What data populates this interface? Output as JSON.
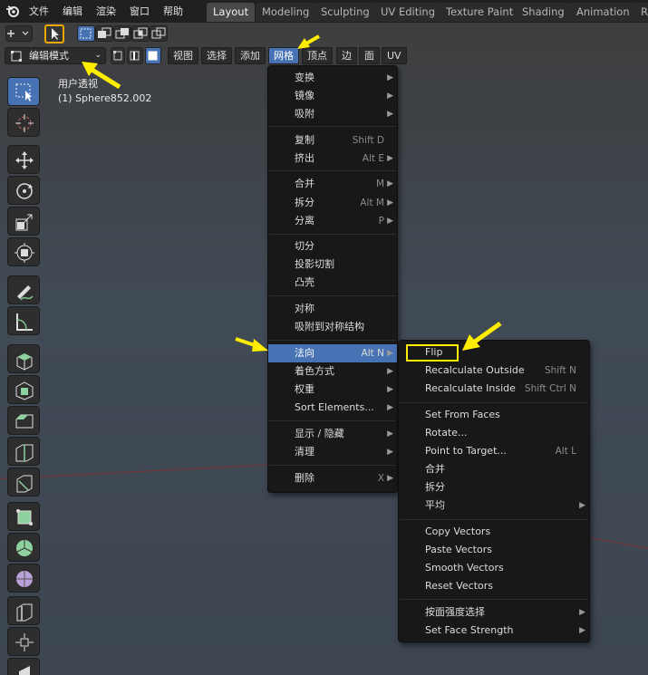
{
  "topbar": {
    "menus": [
      "文件",
      "编辑",
      "渲染",
      "窗口",
      "帮助"
    ],
    "tabs": [
      "Layout",
      "Modeling",
      "Sculpting",
      "UV Editing",
      "Texture Paint",
      "Shading",
      "Animation",
      "R"
    ]
  },
  "header": {
    "mode": "编辑模式",
    "menus": [
      "视图",
      "选择",
      "添加",
      "网格",
      "顶点",
      "边",
      "面",
      "UV"
    ]
  },
  "viewport": {
    "view_name": "用户透视",
    "object_name": "(1) Sphere852.002"
  },
  "mesh_menu": {
    "items": [
      {
        "label": "变换",
        "shortcut": "",
        "sub": true
      },
      {
        "label": "镜像",
        "shortcut": "",
        "sub": true
      },
      {
        "label": "吸附",
        "shortcut": "",
        "sub": true
      },
      {
        "label": "复制",
        "shortcut": "Shift D",
        "sub": false
      },
      {
        "label": "挤出",
        "shortcut": "Alt E",
        "sub": true
      },
      {
        "label": "合并",
        "shortcut": "M",
        "sub": true
      },
      {
        "label": "拆分",
        "shortcut": "Alt M",
        "sub": true
      },
      {
        "label": "分离",
        "shortcut": "P",
        "sub": true
      },
      {
        "label": "切分",
        "shortcut": "",
        "sub": false
      },
      {
        "label": "投影切割",
        "shortcut": "",
        "sub": false
      },
      {
        "label": "凸壳",
        "shortcut": "",
        "sub": false
      },
      {
        "label": "对称",
        "shortcut": "",
        "sub": false
      },
      {
        "label": "吸附到对称结构",
        "shortcut": "",
        "sub": false
      },
      {
        "label": "法向",
        "shortcut": "Alt N",
        "sub": true
      },
      {
        "label": "着色方式",
        "shortcut": "",
        "sub": true
      },
      {
        "label": "权重",
        "shortcut": "",
        "sub": true
      },
      {
        "label": "Sort Elements...",
        "shortcut": "",
        "sub": true
      },
      {
        "label": "显示 / 隐藏",
        "shortcut": "",
        "sub": true
      },
      {
        "label": "清理",
        "shortcut": "",
        "sub": true
      },
      {
        "label": "删除",
        "shortcut": "X",
        "sub": true
      }
    ]
  },
  "normals_menu": {
    "items": [
      {
        "label": "Flip",
        "shortcut": "",
        "sub": false
      },
      {
        "label": "Recalculate Outside",
        "shortcut": "Shift N",
        "sub": false
      },
      {
        "label": "Recalculate Inside",
        "shortcut": "Shift Ctrl N",
        "sub": false
      },
      {
        "label": "Set From Faces",
        "shortcut": "",
        "sub": false
      },
      {
        "label": "Rotate...",
        "shortcut": "",
        "sub": false
      },
      {
        "label": "Point to Target...",
        "shortcut": "Alt L",
        "sub": false
      },
      {
        "label": "合并",
        "shortcut": "",
        "sub": false
      },
      {
        "label": "拆分",
        "shortcut": "",
        "sub": false
      },
      {
        "label": "平均",
        "shortcut": "",
        "sub": true
      },
      {
        "label": "Copy Vectors",
        "shortcut": "",
        "sub": false
      },
      {
        "label": "Paste Vectors",
        "shortcut": "",
        "sub": false
      },
      {
        "label": "Smooth Vectors",
        "shortcut": "",
        "sub": false
      },
      {
        "label": "Reset Vectors",
        "shortcut": "",
        "sub": false
      },
      {
        "label": "按面强度选择",
        "shortcut": "",
        "sub": true
      },
      {
        "label": "Set Face Strength",
        "shortcut": "",
        "sub": true
      }
    ]
  },
  "colors": {
    "accent": "#4772b3",
    "annotation": "#ffee00"
  }
}
